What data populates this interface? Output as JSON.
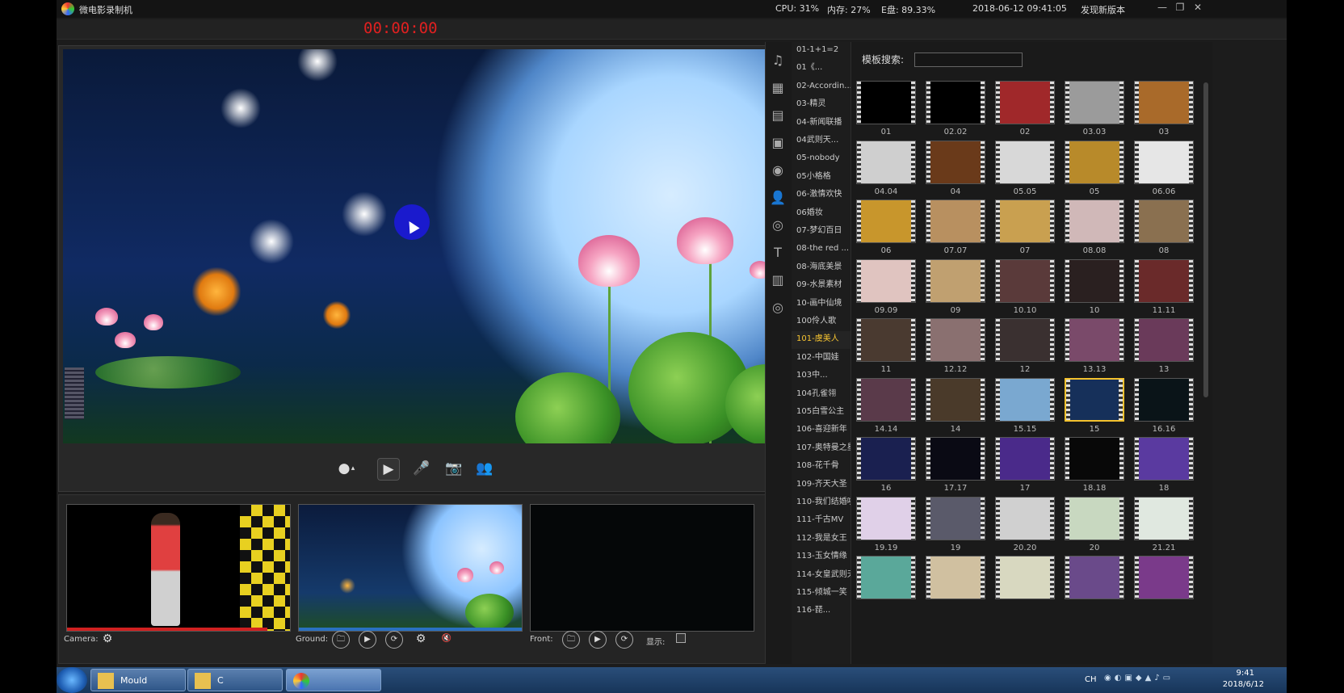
{
  "window": {
    "title": "微电影录制机",
    "stats": {
      "cpu": "CPU: 31%",
      "memory": "内存: 27%",
      "disk": "E盘: 89.33%"
    },
    "datetime": "2018-06-12 09:41:05",
    "update": "发现新版本",
    "controls": {
      "minimize": "—",
      "restore": "❐",
      "close": "✕"
    }
  },
  "timer": "00:00:00",
  "preview": {
    "controls": {
      "record": "●",
      "record_menu": "▴",
      "play": "▶",
      "mic": "🎤",
      "camera": "📷",
      "people": "👥"
    }
  },
  "monitors": {
    "camera_label": "Camera:",
    "ground_label": "Ground:",
    "front_label": "Front:",
    "show_label": "显示:",
    "icons": {
      "folder": "🗀",
      "play": "▶",
      "loop": "⟳",
      "settings": "⚙",
      "mute": "🔇"
    }
  },
  "categories": [
    "♫",
    "▦",
    "▤",
    "▣",
    "◉",
    "👤",
    "◎",
    "T",
    "▥",
    "◎"
  ],
  "templates": [
    "01-1+1=2",
    "01《...",
    "02-Accordin...",
    "03-精灵",
    "04-新闻联播",
    "04武则天...",
    "05-nobody",
    "05小格格",
    "06-激情欢快",
    "06婚妆",
    "07-梦幻百日",
    "08-the red ...",
    "08-海底美景",
    "09-水景素材",
    "10-画中仙境",
    "100伶人歌",
    "101-虞美人",
    "102-中国娃",
    "103中...",
    "104孔雀翎",
    "105白雪公主",
    "106-喜迎新年",
    "107-奥特曼之星",
    "108-花千骨",
    "109-齐天大圣",
    "110-我们结婚啦",
    "111-千古MV",
    "112-我是女王",
    "113-玉女情缘",
    "114-女皇武则天",
    "115-倾城一笑",
    "116-琵..."
  ],
  "selected_template": "101-虞美人",
  "search": {
    "label": "模板搜索:",
    "value": ""
  },
  "thumbs": [
    {
      "label": "01",
      "bg": "#000000"
    },
    {
      "label": "02.02",
      "bg": "#000000"
    },
    {
      "label": "02",
      "bg": "#a0282a"
    },
    {
      "label": "03.03",
      "bg": "#9b9b9b"
    },
    {
      "label": "03",
      "bg": "#a96a2a"
    },
    {
      "label": "04.04",
      "bg": "#cfcfcf"
    },
    {
      "label": "04",
      "bg": "#6a3a1a"
    },
    {
      "label": "05.05",
      "bg": "#d8d8d8"
    },
    {
      "label": "05",
      "bg": "#b88a2a"
    },
    {
      "label": "06.06",
      "bg": "#e6e6e6"
    },
    {
      "label": "06",
      "bg": "#c8962c"
    },
    {
      "label": "07.07",
      "bg": "#b89060"
    },
    {
      "label": "07",
      "bg": "#c9a050"
    },
    {
      "label": "08.08",
      "bg": "#d0b8b8"
    },
    {
      "label": "08",
      "bg": "#8a7050"
    },
    {
      "label": "09.09",
      "bg": "#e0c4c0"
    },
    {
      "label": "09",
      "bg": "#c0a070"
    },
    {
      "label": "10.10",
      "bg": "#5a3a3a"
    },
    {
      "label": "10",
      "bg": "#2a2020"
    },
    {
      "label": "11.11",
      "bg": "#6a2a2a"
    },
    {
      "label": "11",
      "bg": "#4a3a30"
    },
    {
      "label": "12.12",
      "bg": "#8a7070"
    },
    {
      "label": "12",
      "bg": "#3a3030"
    },
    {
      "label": "13.13",
      "bg": "#7a4a6a"
    },
    {
      "label": "13",
      "bg": "#6a3a5a"
    },
    {
      "label": "14.14",
      "bg": "#5a3a4a"
    },
    {
      "label": "14",
      "bg": "#4a3a2a"
    },
    {
      "label": "15.15",
      "bg": "#7aa8d0"
    },
    {
      "label": "15",
      "bg": "#16305a",
      "selected": true
    },
    {
      "label": "16.16",
      "bg": "#0a1418"
    },
    {
      "label": "16",
      "bg": "#1a2050"
    },
    {
      "label": "17.17",
      "bg": "#0a0a14"
    },
    {
      "label": "17",
      "bg": "#4a2a8a"
    },
    {
      "label": "18.18",
      "bg": "#080808"
    },
    {
      "label": "18",
      "bg": "#5a3aa0"
    },
    {
      "label": "19.19",
      "bg": "#e0d0e8"
    },
    {
      "label": "19",
      "bg": "#5a5a6a"
    },
    {
      "label": "20.20",
      "bg": "#d0d0d0"
    },
    {
      "label": "20",
      "bg": "#c8d8c0"
    },
    {
      "label": "21.21",
      "bg": "#e0e8e0"
    },
    {
      "label": "",
      "bg": "#5aa89a"
    },
    {
      "label": "",
      "bg": "#d0c0a0"
    },
    {
      "label": "",
      "bg": "#d8d8c0"
    },
    {
      "label": "",
      "bg": "#6a4a8a"
    },
    {
      "label": "",
      "bg": "#7a3a8a"
    }
  ],
  "taskbar": {
    "items": [
      "Mould",
      "C",
      ""
    ],
    "tray": "CH",
    "time": "9:41",
    "date": "2018/6/12"
  },
  "colors": {
    "accent": "#f4c22e",
    "timer": "#e02020"
  }
}
